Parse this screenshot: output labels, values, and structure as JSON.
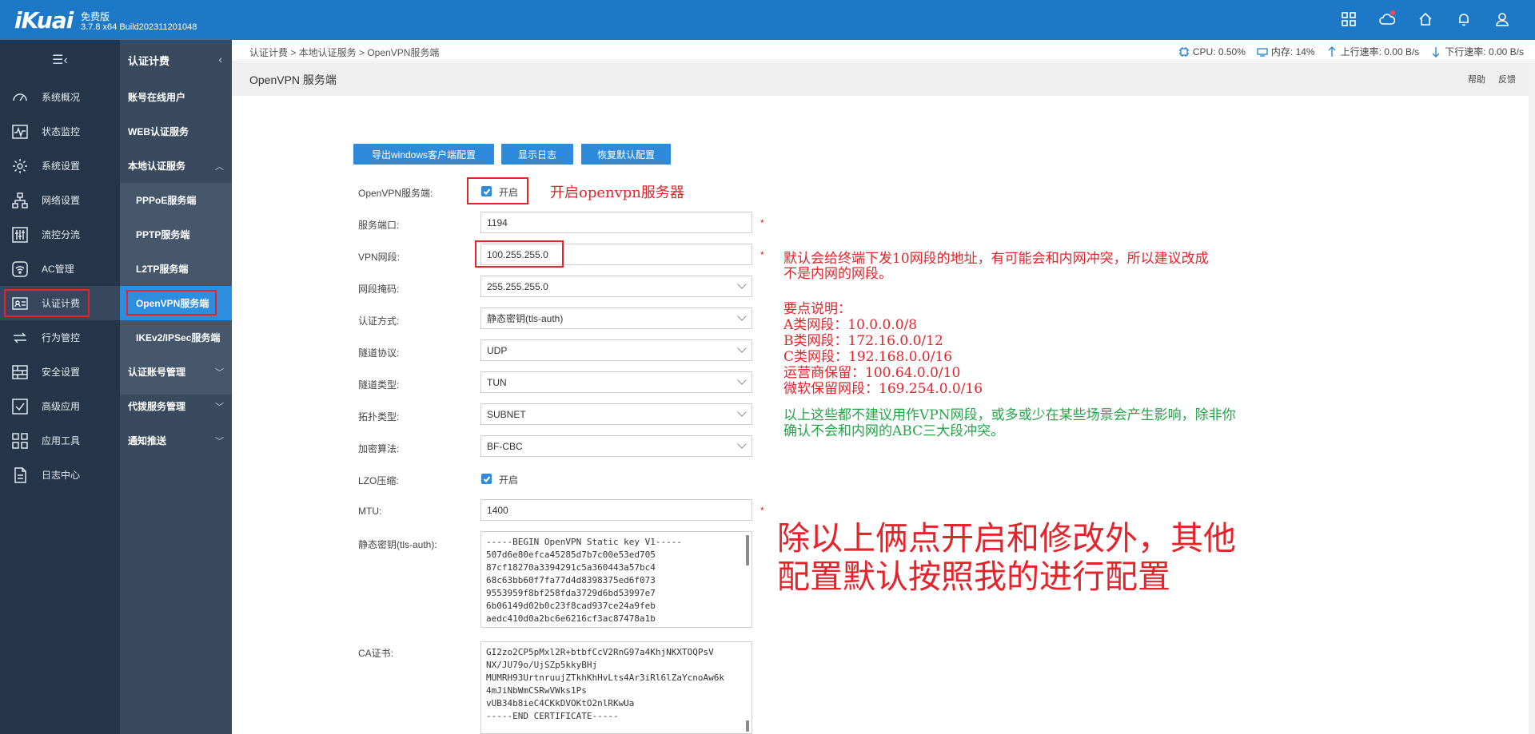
{
  "header": {
    "logo": "iKuai",
    "edition": "免费版",
    "version": "3.7.8 x64 Build202311201048",
    "icons": [
      "apps-icon",
      "cloud-icon",
      "home-icon",
      "bell-icon",
      "user-icon"
    ]
  },
  "sidebar": {
    "items": [
      {
        "label": "系统概况",
        "icon": "dashboard-icon"
      },
      {
        "label": "状态监控",
        "icon": "monitor-icon"
      },
      {
        "label": "系统设置",
        "icon": "gear-icon"
      },
      {
        "label": "网络设置",
        "icon": "network-icon"
      },
      {
        "label": "流控分流",
        "icon": "sliders-icon"
      },
      {
        "label": "AC管理",
        "icon": "wifi-icon"
      },
      {
        "label": "认证计费",
        "icon": "idcard-icon"
      },
      {
        "label": "行为管控",
        "icon": "arrows-icon"
      },
      {
        "label": "安全设置",
        "icon": "shield-icon"
      },
      {
        "label": "高级应用",
        "icon": "check-icon"
      },
      {
        "label": "应用工具",
        "icon": "tools-icon"
      },
      {
        "label": "日志中心",
        "icon": "log-icon"
      }
    ]
  },
  "submenu": {
    "title": "认证计费",
    "items": [
      {
        "label": "账号在线用户"
      },
      {
        "label": "WEB认证服务"
      },
      {
        "label": "本地认证服务"
      },
      {
        "label": "PPPoE服务端"
      },
      {
        "label": "PPTP服务端"
      },
      {
        "label": "L2TP服务端"
      },
      {
        "label": "OpenVPN服务端"
      },
      {
        "label": "IKEv2/IPSec服务端"
      },
      {
        "label": "认证账号管理"
      },
      {
        "label": "代拨服务管理"
      },
      {
        "label": "通知推送"
      }
    ]
  },
  "status": {
    "breadcrumb": "认证计费 > 本地认证服务 > OpenVPN服务端",
    "cpu": "CPU: 0.50%",
    "mem": "内存: 14%",
    "up": "上行速率: 0.00 B/s",
    "down": "下行速率: 0.00 B/s"
  },
  "page": {
    "title": "OpenVPN 服务端",
    "help": "帮助",
    "feedback": "反馈"
  },
  "buttons": {
    "export": "导出windows客户端配置",
    "log": "显示日志",
    "reset": "恢复默认配置"
  },
  "form": {
    "service_label": "OpenVPN服务端:",
    "service_check": "开启",
    "port_label": "服务端口:",
    "port_value": "1194",
    "net_label": "VPN网段:",
    "net_value": "100.255.255.0",
    "mask_label": "网段掩码:",
    "mask_value": "255.255.255.0",
    "auth_label": "认证方式:",
    "auth_value": "静态密钥(tls-auth)",
    "proto_label": "隧道协议:",
    "proto_value": "UDP",
    "tun_label": "隧道类型:",
    "tun_value": "TUN",
    "topo_label": "拓扑类型:",
    "topo_value": "SUBNET",
    "cipher_label": "加密算法:",
    "cipher_value": "BF-CBC",
    "lzo_label": "LZO压缩:",
    "lzo_check": "开启",
    "mtu_label": "MTU:",
    "mtu_value": "1400",
    "key_label": "静态密钥(tls-auth):",
    "key_lines": [
      "-----BEGIN OpenVPN Static key V1-----",
      "507d6e80efca45285d7b7c00e53ed705",
      "87cf18270a3394291c5a360443a57bc4",
      "68c63bb60f7fa77d4d8398375ed6f073",
      "9553959f8bf258fda3729d6bd53997e7",
      "6b06149d02b0c23f8cad937ce24a9feb",
      "aedc410d0a2bc6e6216cf3ac87478a1b"
    ],
    "ca_label": "CA证书:",
    "ca_lines": [
      "GI2zo2CP5pMxl2R+btbfCcV2RnG97a4KhjNKXTOQPsV",
      "NX/JU79o/UjSZp5kkyBHj",
      "MUMRH93UrtnruujZTkhKhHvLts4Ar3iRl6lZaYcnoAw6k",
      "4mJiNbWmCSRwVWks1Ps",
      "vUB34b8ieC4CKkDVOKtO2nlRKwUa",
      "-----END CERTIFICATE-----"
    ],
    "required_mark": "*"
  },
  "annotations": {
    "openvpn": "开启openvpn服务器",
    "net_note_1": "默认会给终端下发10网段的地址，有可能会和内网冲突，所以建议改成",
    "net_note_2": "不是内网的网段。",
    "points_title": "要点说明：",
    "point_a": "A类网段：10.0.0.0/8",
    "point_b": "B类网段：172.16.0.0/12",
    "point_c": "C类网段：192.168.0.0/16",
    "point_isp": "运营商保留：100.64.0.0/10",
    "point_ms": "微软保留网段：169.254.0.0/16",
    "green_1": "以上这些都不建议用作VPN网段，或多或少在某些场景会产生影响，除非你",
    "green_2": "确认不会和内网的ABC三大段冲突。",
    "big_1": "除以上俩点开启和修改外，其他",
    "big_2": "配置默认按照我的进行配置"
  }
}
